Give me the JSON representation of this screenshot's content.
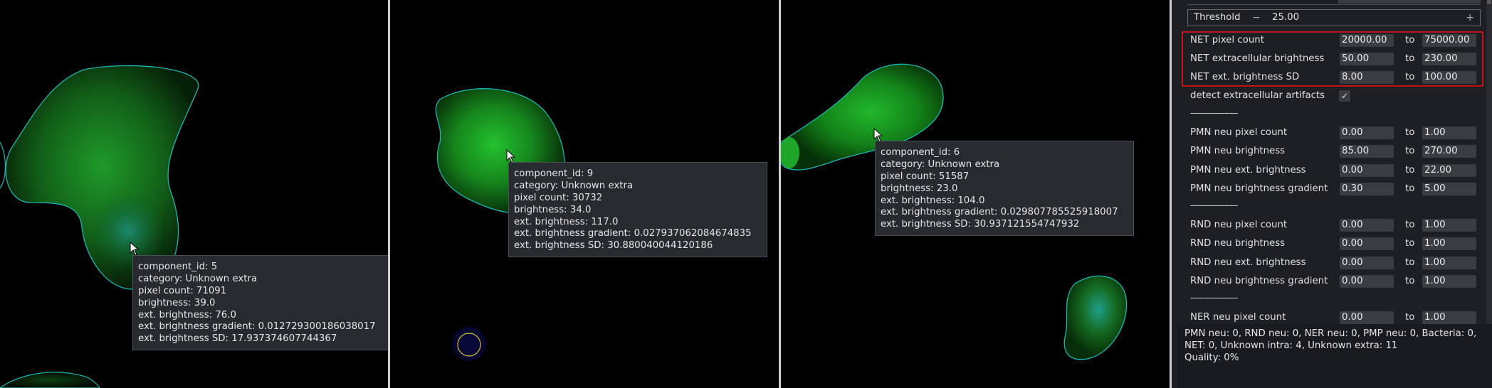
{
  "tooltips": [
    {
      "lines": [
        "component_id: 5",
        "category: Unknown extra",
        "pixel count: 71091",
        "brightness: 39.0",
        "ext. brightness: 76.0",
        "ext. brightness gradient: 0.012729300186038017",
        "ext. brightness SD: 17.937374607744367"
      ]
    },
    {
      "lines": [
        "component_id: 9",
        "category: Unknown extra",
        "pixel count: 30732",
        "brightness: 34.0",
        "ext. brightness: 117.0",
        "ext. brightness gradient: 0.027937062084674835",
        "ext. brightness SD: 30.880040044120186"
      ]
    },
    {
      "lines": [
        "component_id: 6",
        "category: Unknown extra",
        "pixel count: 51587",
        "brightness: 23.0",
        "ext. brightness: 104.0",
        "ext. brightness gradient: 0.029807785525918007",
        "ext. brightness SD: 30.937121554747932"
      ]
    }
  ],
  "threshold": {
    "label": "Threshold",
    "minus": "−",
    "value": "25.00",
    "plus": "+"
  },
  "rows": [
    {
      "label": "NET pixel count",
      "from": "20000.00",
      "to_label": "to",
      "to": "75000.00"
    },
    {
      "label": "NET extracellular brightness",
      "from": "50.00",
      "to_label": "to",
      "to": "230.00"
    },
    {
      "label": "NET ext. brightness SD",
      "from": "8.00",
      "to_label": "to",
      "to": "100.00"
    },
    {
      "label": "PMN neu pixel count",
      "from": "0.00",
      "to_label": "to",
      "to": "1.00"
    },
    {
      "label": "PMN neu brightness",
      "from": "85.00",
      "to_label": "to",
      "to": "270.00"
    },
    {
      "label": "PMN neu ext. brightness",
      "from": "0.00",
      "to_label": "to",
      "to": "22.00"
    },
    {
      "label": "PMN neu brightness gradient",
      "from": "0.30",
      "to_label": "to",
      "to": "5.00"
    },
    {
      "label": "RND neu pixel count",
      "from": "0.00",
      "to_label": "to",
      "to": "1.00"
    },
    {
      "label": "RND neu brightness",
      "from": "0.00",
      "to_label": "to",
      "to": "1.00"
    },
    {
      "label": "RND neu ext. brightness",
      "from": "0.00",
      "to_label": "to",
      "to": "1.00"
    },
    {
      "label": "RND neu brightness gradient",
      "from": "0.00",
      "to_label": "to",
      "to": "1.00"
    },
    {
      "label": "NER neu pixel count",
      "from": "0.00",
      "to_label": "to",
      "to": "1.00"
    }
  ],
  "checkbox": {
    "label": "detect extracellular artifacts",
    "checked": true,
    "mark": "✓"
  },
  "separators": [
    "------------------",
    "------------------",
    "------------------"
  ],
  "status": {
    "lines": [
      "PMN neu: 0, RND neu: 0, NER neu: 0, PMP neu: 0, Bacteria: 0,",
      "NET: 0, Unknown intra: 4, Unknown extra: 11",
      "Quality: 0%"
    ]
  },
  "colors": {
    "contour_cyan": "#1fb5b0",
    "contour_yellow": "#d4c23a",
    "highlight_red": "#c0141d",
    "cell_green": "#1faa2a"
  }
}
